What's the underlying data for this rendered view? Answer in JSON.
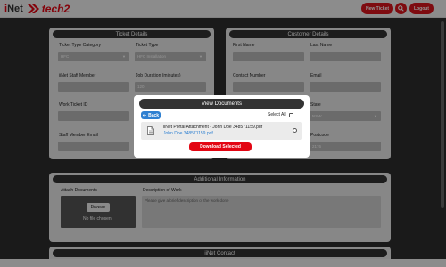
{
  "header": {
    "logo_prefix": "i",
    "logo_main": "Net",
    "logo_tech": "tech2",
    "new_ticket_label": "New Ticket",
    "search_icon": "search-icon",
    "logout_label": "Logout",
    "accent_color": "#d9141c"
  },
  "ticket_details": {
    "title": "Ticket Details",
    "ticket_type_category_label": "Ticket Type Category",
    "ticket_type_category_value": "HFC",
    "ticket_type_label": "Ticket Type",
    "ticket_type_value": "HFC Installation",
    "staff_member_label": "iiNet Staff Member",
    "staff_member_value": "",
    "job_duration_label": "Job Duration (minutes)",
    "job_duration_value": "120",
    "work_ticket_id_label": "Work Ticket ID",
    "work_ticket_id_value": "",
    "staff_email_label": "Staff Member Email",
    "staff_email_value": ""
  },
  "customer_details": {
    "title": "Customer Details",
    "first_name_label": "First Name",
    "last_name_label": "Last Name",
    "contact_number_label": "Contact Number",
    "email_label": "Email",
    "state_label": "State",
    "state_value": "NSW",
    "postcode_label": "Postcode",
    "postcode_value": "2176"
  },
  "additional_info": {
    "title": "Additional Information",
    "attach_label": "Attach Documents",
    "browse_label": "Browse",
    "no_file_label": "No file chosen",
    "description_label": "Description of Work",
    "description_placeholder": "Please give a brief description of the work done"
  },
  "contact_section": {
    "title": "iiNet Contact"
  },
  "modal": {
    "title": "View Documents",
    "back_label": "Back",
    "select_all_label": "Select All",
    "document_name": "iiNet Portal Attachment - John Doe 348571159.pdf",
    "document_link": "John Doe 348571159.pdf",
    "download_label": "Download Selected",
    "document_icon": "file-icon"
  },
  "footer": {
    "left_text": "",
    "right_text": ""
  }
}
